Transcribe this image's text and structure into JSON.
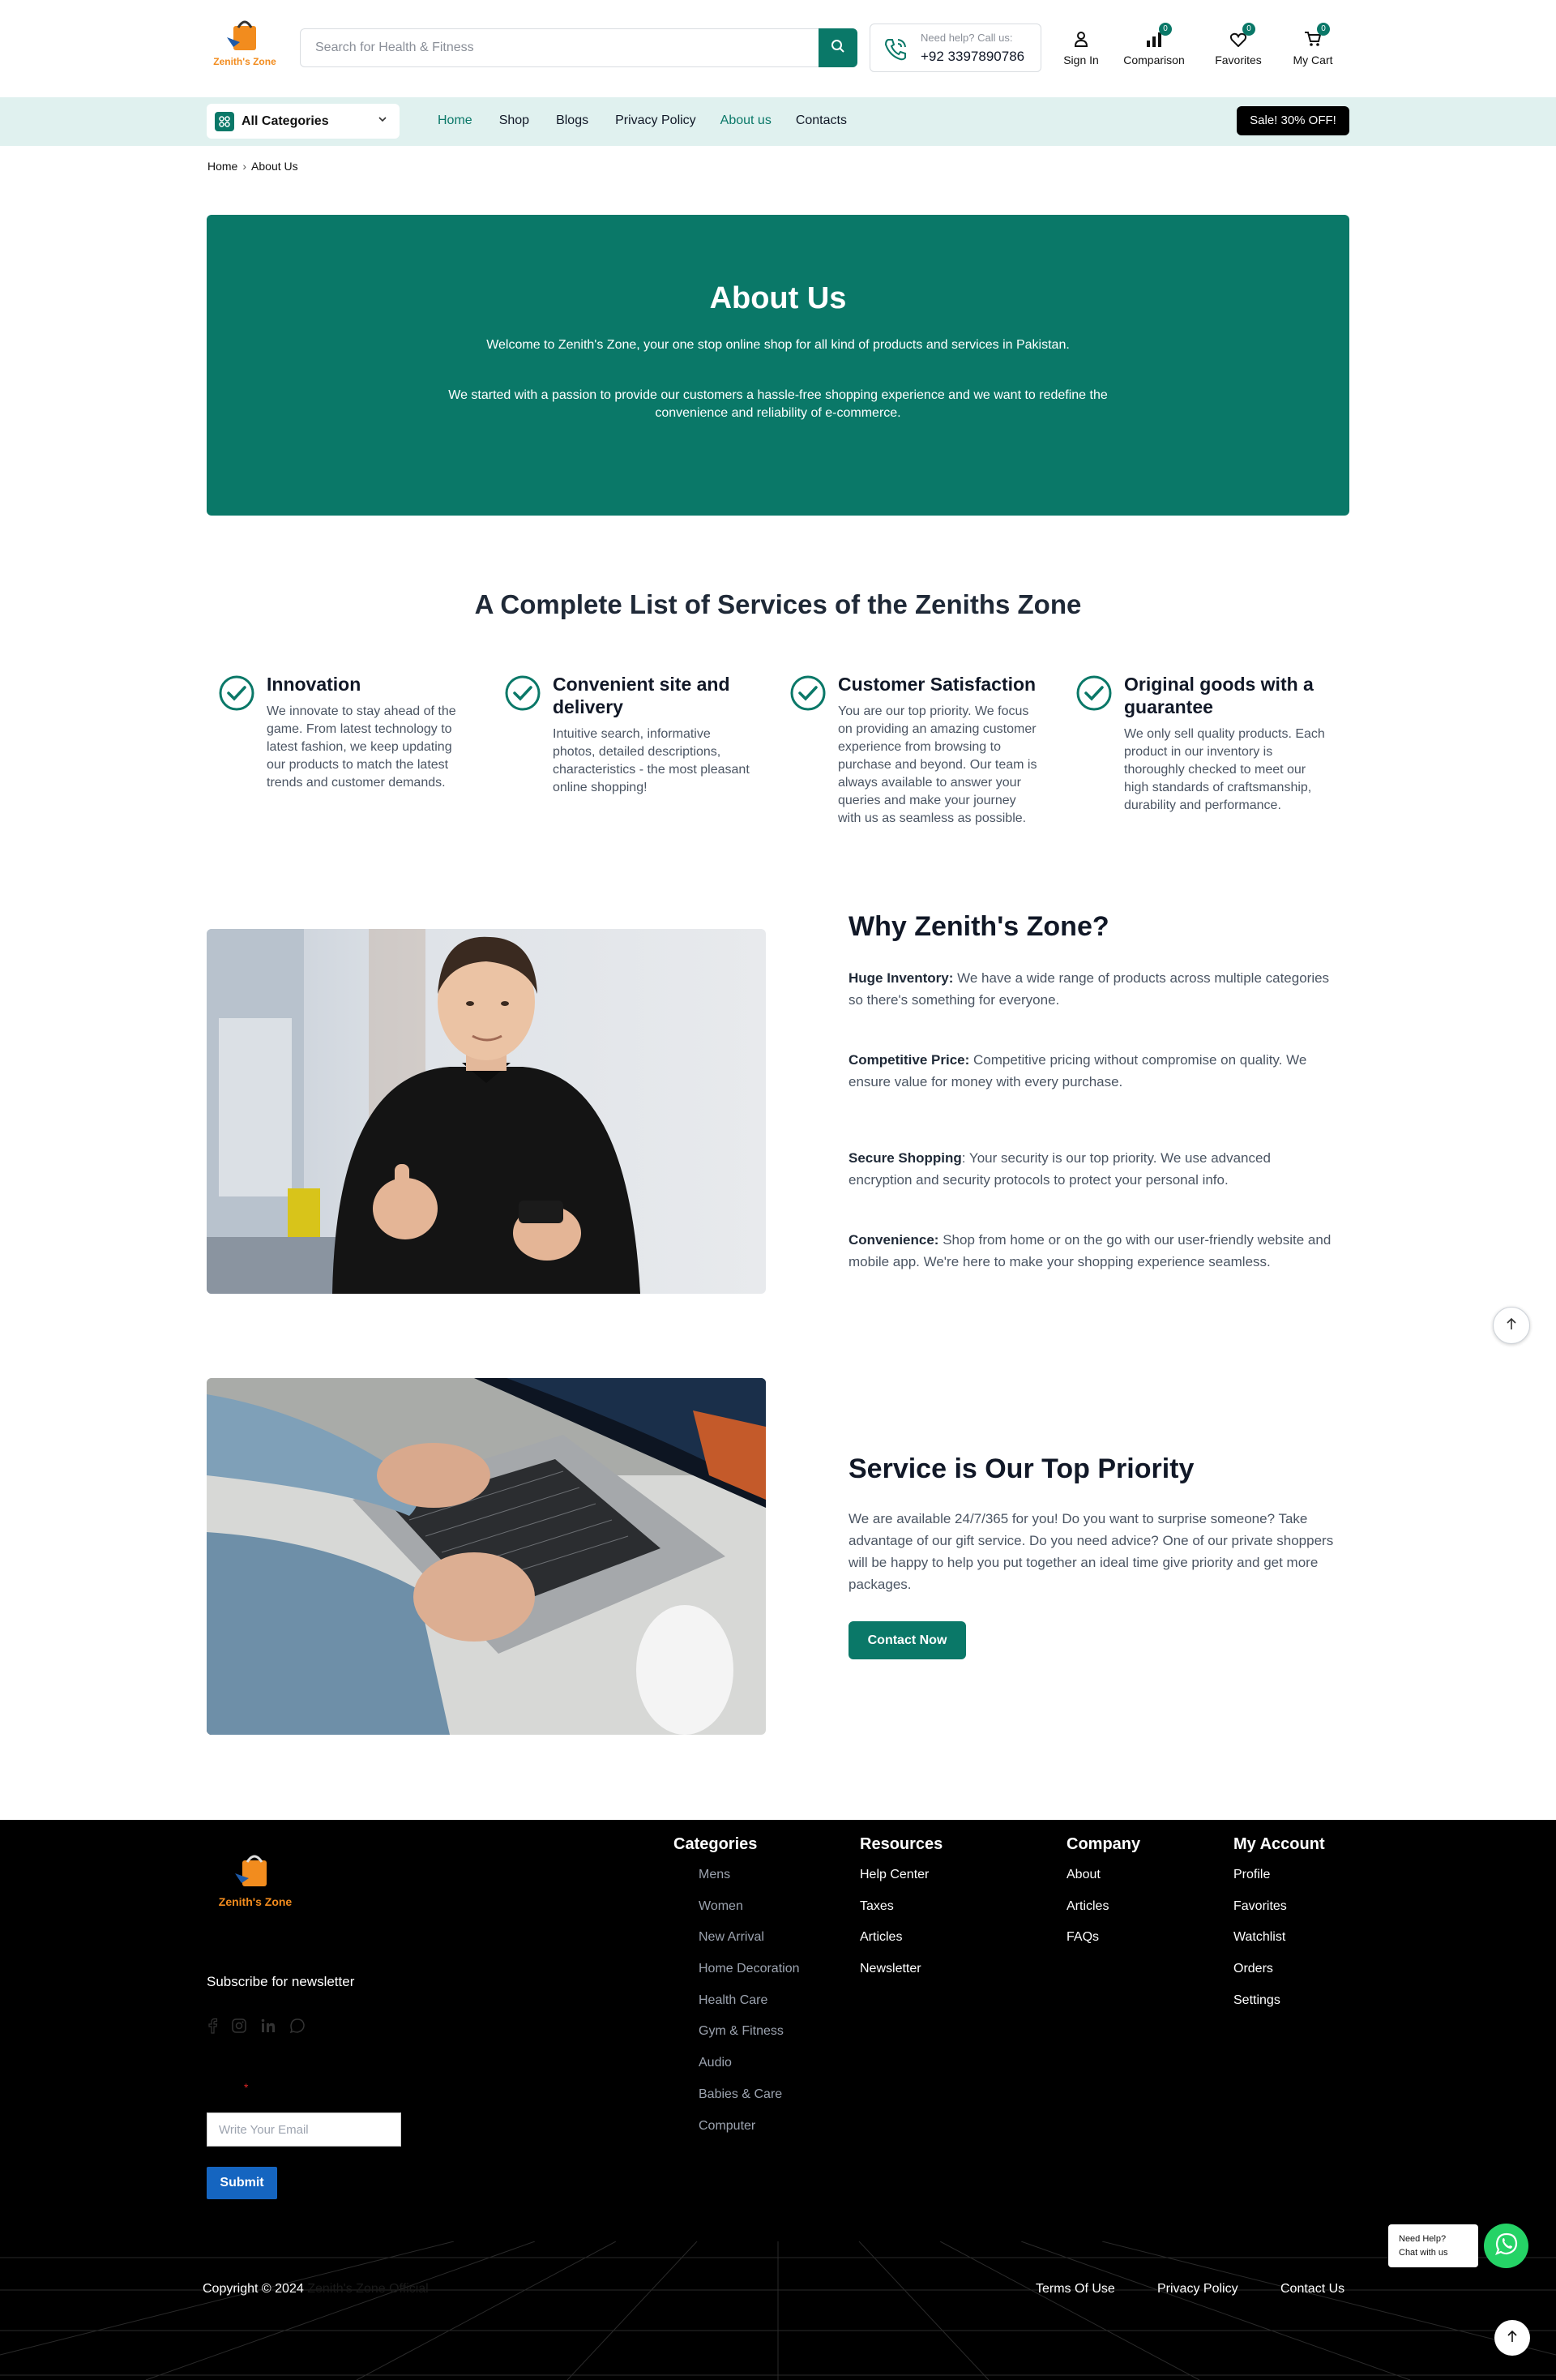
{
  "header": {
    "logo_text": "Zenith's Zone",
    "search_placeholder": "Search for Health & Fitness",
    "help_label": "Need help? Call us:",
    "help_phone": "+92 3397890786",
    "icons": [
      {
        "label": "Sign In",
        "icon": "user-icon"
      },
      {
        "label": "Comparison",
        "icon": "bar-chart-icon",
        "badge": "0"
      },
      {
        "label": "Favorites",
        "icon": "heart-icon",
        "badge": "0"
      },
      {
        "label": "My Cart",
        "icon": "cart-icon",
        "badge": "0"
      }
    ]
  },
  "nav": {
    "categories_label": "All Categories",
    "links": [
      {
        "label": "Home",
        "active": true
      },
      {
        "label": "Shop"
      },
      {
        "label": "Blogs"
      },
      {
        "label": "Privacy Policy"
      },
      {
        "label": "About us",
        "active": true
      },
      {
        "label": "Contacts"
      }
    ],
    "sale_label": "Sale! 30% OFF!"
  },
  "breadcrumb": {
    "home": "Home",
    "current": "About Us"
  },
  "hero": {
    "title": "About Us",
    "p1": "Welcome to Zenith's Zone, your one stop online shop for all kind of products and services in Pakistan.",
    "p2": "We started with a passion to provide our customers a hassle-free shopping experience and we want to redefine the convenience and reliability of e-commerce."
  },
  "services": {
    "title": "A Complete List of Services of the Zeniths Zone",
    "items": [
      {
        "title": "Innovation",
        "text": "We innovate to stay ahead of the game. From latest technology to latest fashion, we keep updating our products to match the latest trends and customer demands."
      },
      {
        "title": "Convenient site and delivery",
        "text": "Intuitive search, informative photos, detailed descriptions, characteristics - the most pleasant online shopping!"
      },
      {
        "title": "Customer Satisfaction",
        "text": "You are our top priority. We focus on providing an amazing customer experience from browsing to purchase and beyond. Our team is always available to answer your queries and make your journey with us as seamless as possible."
      },
      {
        "title": "Original goods with a guarantee",
        "text": "We only sell quality products. Each product in our inventory is thoroughly checked to meet our high standards of craftsmanship, durability and performance."
      }
    ]
  },
  "why": {
    "title": "Why Zenith's Zone?",
    "items": [
      {
        "label": "Huge Inventory:",
        "text": " We have a wide range of products across multiple categories so there's something for everyone."
      },
      {
        "label": "Competitive Price:",
        "text": " Competitive pricing without compromise on quality. We ensure value for money with every purchase."
      },
      {
        "label": "Secure Shopping",
        "text": ": Your security is our top priority. We use advanced encryption and security protocols to protect your personal info."
      },
      {
        "label": "Convenience:",
        "text": " Shop from home or on the go with our user-friendly website and mobile app. We're here to make your shopping experience seamless."
      }
    ]
  },
  "priority": {
    "title": "Service is Our Top Priority",
    "text": "We are available 24/7/365 for you! Do you want to surprise someone? Take advantage of our gift service. Do you need advice? One of our private shoppers will be happy to help you put together an ideal time give priority and get more packages.",
    "button": "Contact Now"
  },
  "footer": {
    "logo_text": "Zenith's Zone",
    "newsletter": "Subscribe for newsletter",
    "required_mark": "*",
    "email_placeholder": "Write Your Email",
    "submit": "Submit",
    "columns": {
      "categories": {
        "title": "Categories",
        "links": [
          "Mens",
          "Women",
          "New Arrival",
          "Home Decoration",
          "Health Care",
          "Gym & Fitness",
          "Audio",
          "Babies & Care",
          "Computer"
        ]
      },
      "resources": {
        "title": "Resources",
        "links": [
          "Help Center",
          "Taxes",
          "Articles",
          "Newsletter"
        ]
      },
      "company": {
        "title": "Company",
        "links": [
          "About",
          "Articles",
          "FAQs"
        ]
      },
      "account": {
        "title": "My Account",
        "links": [
          "Profile",
          "Favorites",
          "Watchlist",
          "Orders",
          "Settings"
        ]
      }
    },
    "copyright": "Copyright © 2024",
    "brand": "Zenith's Zone Official",
    "bottom_links": [
      "Terms Of Use",
      "Privacy Policy",
      "Contact Us"
    ]
  },
  "chat": {
    "line1": "Need Help?",
    "line2": "Chat with us"
  },
  "colors": {
    "primary": "#0a7868",
    "nav_bg": "#e0f1ef",
    "footer_bg": "#000000",
    "submit": "#1565c0",
    "whatsapp": "#25d366"
  }
}
